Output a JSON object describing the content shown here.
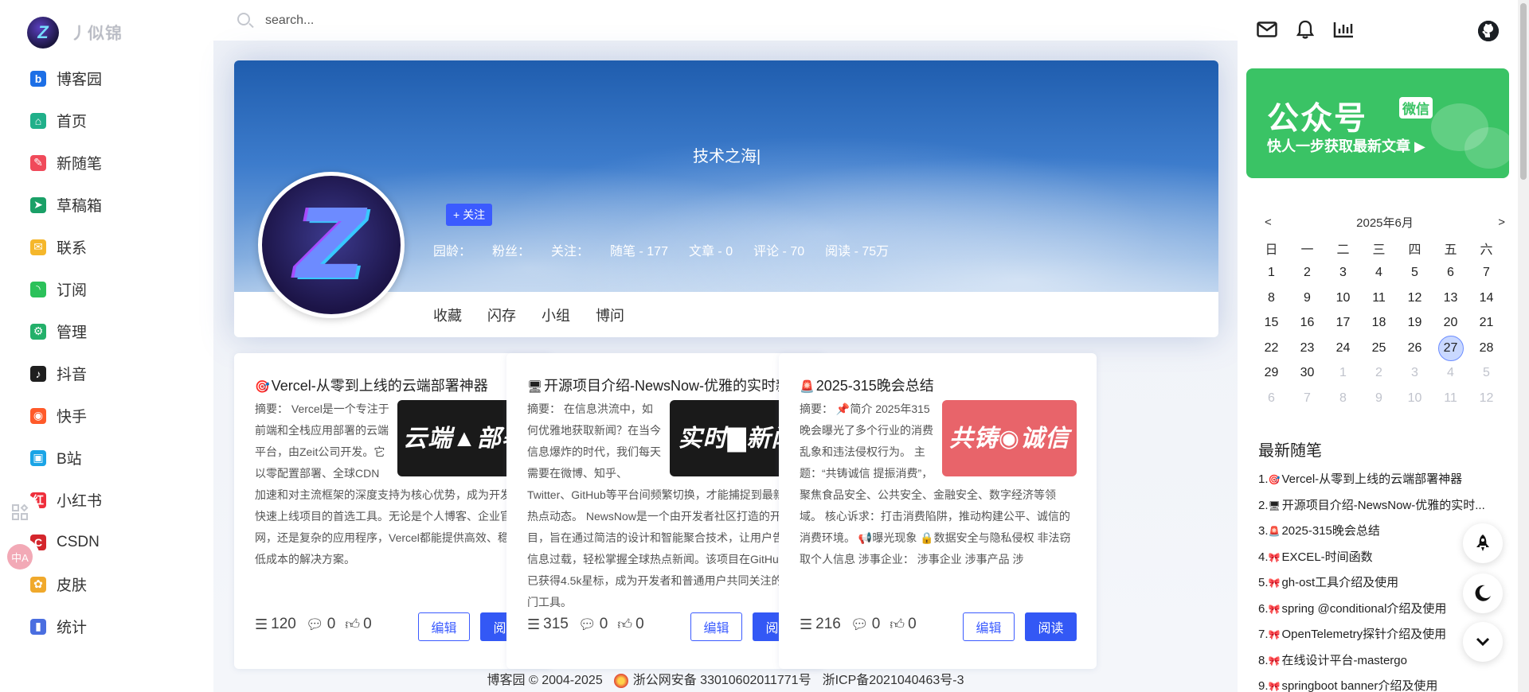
{
  "brand": {
    "name": "丿似锦",
    "logo_letter": "Z"
  },
  "search": {
    "placeholder": "search..."
  },
  "sidebar": {
    "items": [
      {
        "label": "博客园",
        "icon": "b",
        "color": "#1d6fe6"
      },
      {
        "label": "首页",
        "icon": "⌂",
        "color": "#20b08a"
      },
      {
        "label": "新随笔",
        "icon": "✎",
        "color": "#f04a5a"
      },
      {
        "label": "草稿箱",
        "icon": "➤",
        "color": "#1aa067"
      },
      {
        "label": "联系",
        "icon": "✉",
        "color": "#f5b72b"
      },
      {
        "label": "订阅",
        "icon": "◝",
        "color": "#2bc15a"
      },
      {
        "label": "管理",
        "icon": "⚙",
        "color": "#23b06a"
      },
      {
        "label": "抖音",
        "icon": "♪",
        "color": "#1f1f1f"
      },
      {
        "label": "快手",
        "icon": "◉",
        "color": "#ff5a2a"
      },
      {
        "label": "B站",
        "icon": "▣",
        "color": "#1aa4e6"
      },
      {
        "label": "小红书",
        "icon": "红",
        "color": "#ef2f3c"
      },
      {
        "label": "CSDN",
        "icon": "C",
        "color": "#d4262c"
      },
      {
        "label": "皮肤",
        "icon": "✿",
        "color": "#f0a92c"
      },
      {
        "label": "统计",
        "icon": "▮",
        "color": "#4a6ee0"
      }
    ]
  },
  "hero": {
    "text": "技术之海|",
    "follow_label": "+ 关注",
    "stats": [
      "园龄：",
      "粉丝：",
      "关注：",
      "随笔 - 177",
      "文章 - 0",
      "评论 - 70",
      "阅读 - 75万"
    ],
    "tabs": [
      "收藏",
      "闪存",
      "小组",
      "博问"
    ]
  },
  "cards": [
    {
      "emoji": "🎯",
      "title": "Vercel-从零到上线的云端部署神器",
      "thumb_text": "云端▲部署",
      "thumb_color": "#1a1a1a",
      "summary": "摘要： Vercel是一个专注于前端和全栈应用部署的云端平台，由Zeit公司开发。它以零配置部署、全球CDN加速和对主流框架的深度支持为核心优势，成为开发者快速上线项目的首选工具。无论是个人博客、企业官网，还是复杂的应用程序，Vercel都能提供高效、稳定且低成本的解决方案。",
      "views": "120",
      "comments": "0",
      "likes": "0"
    },
    {
      "emoji": "🖥",
      "title": "开源项目介绍-NewsNow-优雅的实时新",
      "thumb_text": "实时▇新闻",
      "thumb_color": "#1a1a1a",
      "summary": "摘要： 在信息洪流中，如何优雅地获取新闻？在当今信息爆炸的时代，我们每天需要在微博、知乎、Twitter、GitHub等平台间频繁切换，才能捕捉到最新的热点动态。 NewsNow是一个由开发者社区打造的开源项目，旨在通过简洁的设计和智能聚合技术，让用户告别信息过载，轻松掌握全球热点新闻。该项目在GitHub上已获得4.5k星标，成为开发者和普通用户共同关注的热门工具。",
      "views": "315",
      "comments": "0",
      "likes": "0"
    },
    {
      "emoji": "🚨",
      "title": "2025-315晚会总结",
      "thumb_text": "共铸◉诚信",
      "thumb_color": "#e8646a",
      "summary": "摘要： 📌简介 2025年315晚会曝光了多个行业的消费乱象和违法侵权行为。 主题：“共铸诚信 提振消费”，聚焦食品安全、公共安全、金融安全、数字经济等领域。 核心诉求：打击消费陷阱，推动构建公平、诚信的消费环境。 📢曝光现象 🔒数据安全与隐私侵权 非法窃取个人信息 涉事企业： 涉事企业 涉事产品 涉",
      "views": "216",
      "comments": "0",
      "likes": "0"
    }
  ],
  "card_buttons": {
    "edit": "编辑",
    "read": "阅读"
  },
  "footer": {
    "copyright": "博客园 ©  2004-2025",
    "police": "浙公网安备 33010602011771号",
    "icp": "浙ICP备2021040463号-3"
  },
  "wechat": {
    "title": "公众号",
    "badge": "微信",
    "subtitle": "快人一步获取最新文章 ▶"
  },
  "calendar": {
    "prev": "<",
    "next": ">",
    "month": "2025年6月",
    "weekdays": [
      "日",
      "一",
      "二",
      "三",
      "四",
      "五",
      "六"
    ],
    "days": [
      "1",
      "2",
      "3",
      "4",
      "5",
      "6",
      "7",
      "8",
      "9",
      "10",
      "11",
      "12",
      "13",
      "14",
      "15",
      "16",
      "17",
      "18",
      "19",
      "20",
      "21",
      "22",
      "23",
      "24",
      "25",
      "26",
      "27",
      "28",
      "29",
      "30",
      "1",
      "2",
      "3",
      "4",
      "5",
      "6",
      "7",
      "8",
      "9",
      "10",
      "11",
      "12"
    ],
    "today": "27"
  },
  "recent": {
    "title": "最新随笔",
    "items": [
      {
        "num": "1.",
        "em": "🎯",
        "text": "Vercel-从零到上线的云端部署神器"
      },
      {
        "num": "2.",
        "em": "🖥",
        "text": "开源项目介绍-NewsNow-优雅的实时..."
      },
      {
        "num": "3.",
        "em": "🚨",
        "text": "2025-315晚会总结"
      },
      {
        "num": "4.",
        "em": "🎀",
        "text": "EXCEL-时间函数"
      },
      {
        "num": "5.",
        "em": "🎀",
        "text": "gh-ost工具介绍及使用"
      },
      {
        "num": "6.",
        "em": "🎀",
        "text": "spring @conditional介绍及使用"
      },
      {
        "num": "7.",
        "em": "🎀",
        "text": "OpenTelemetry探针介绍及使用"
      },
      {
        "num": "8.",
        "em": "🎀",
        "text": "在线设计平台-mastergo"
      },
      {
        "num": "9.",
        "em": "🎀",
        "text": "springboot banner介绍及使用"
      }
    ]
  }
}
